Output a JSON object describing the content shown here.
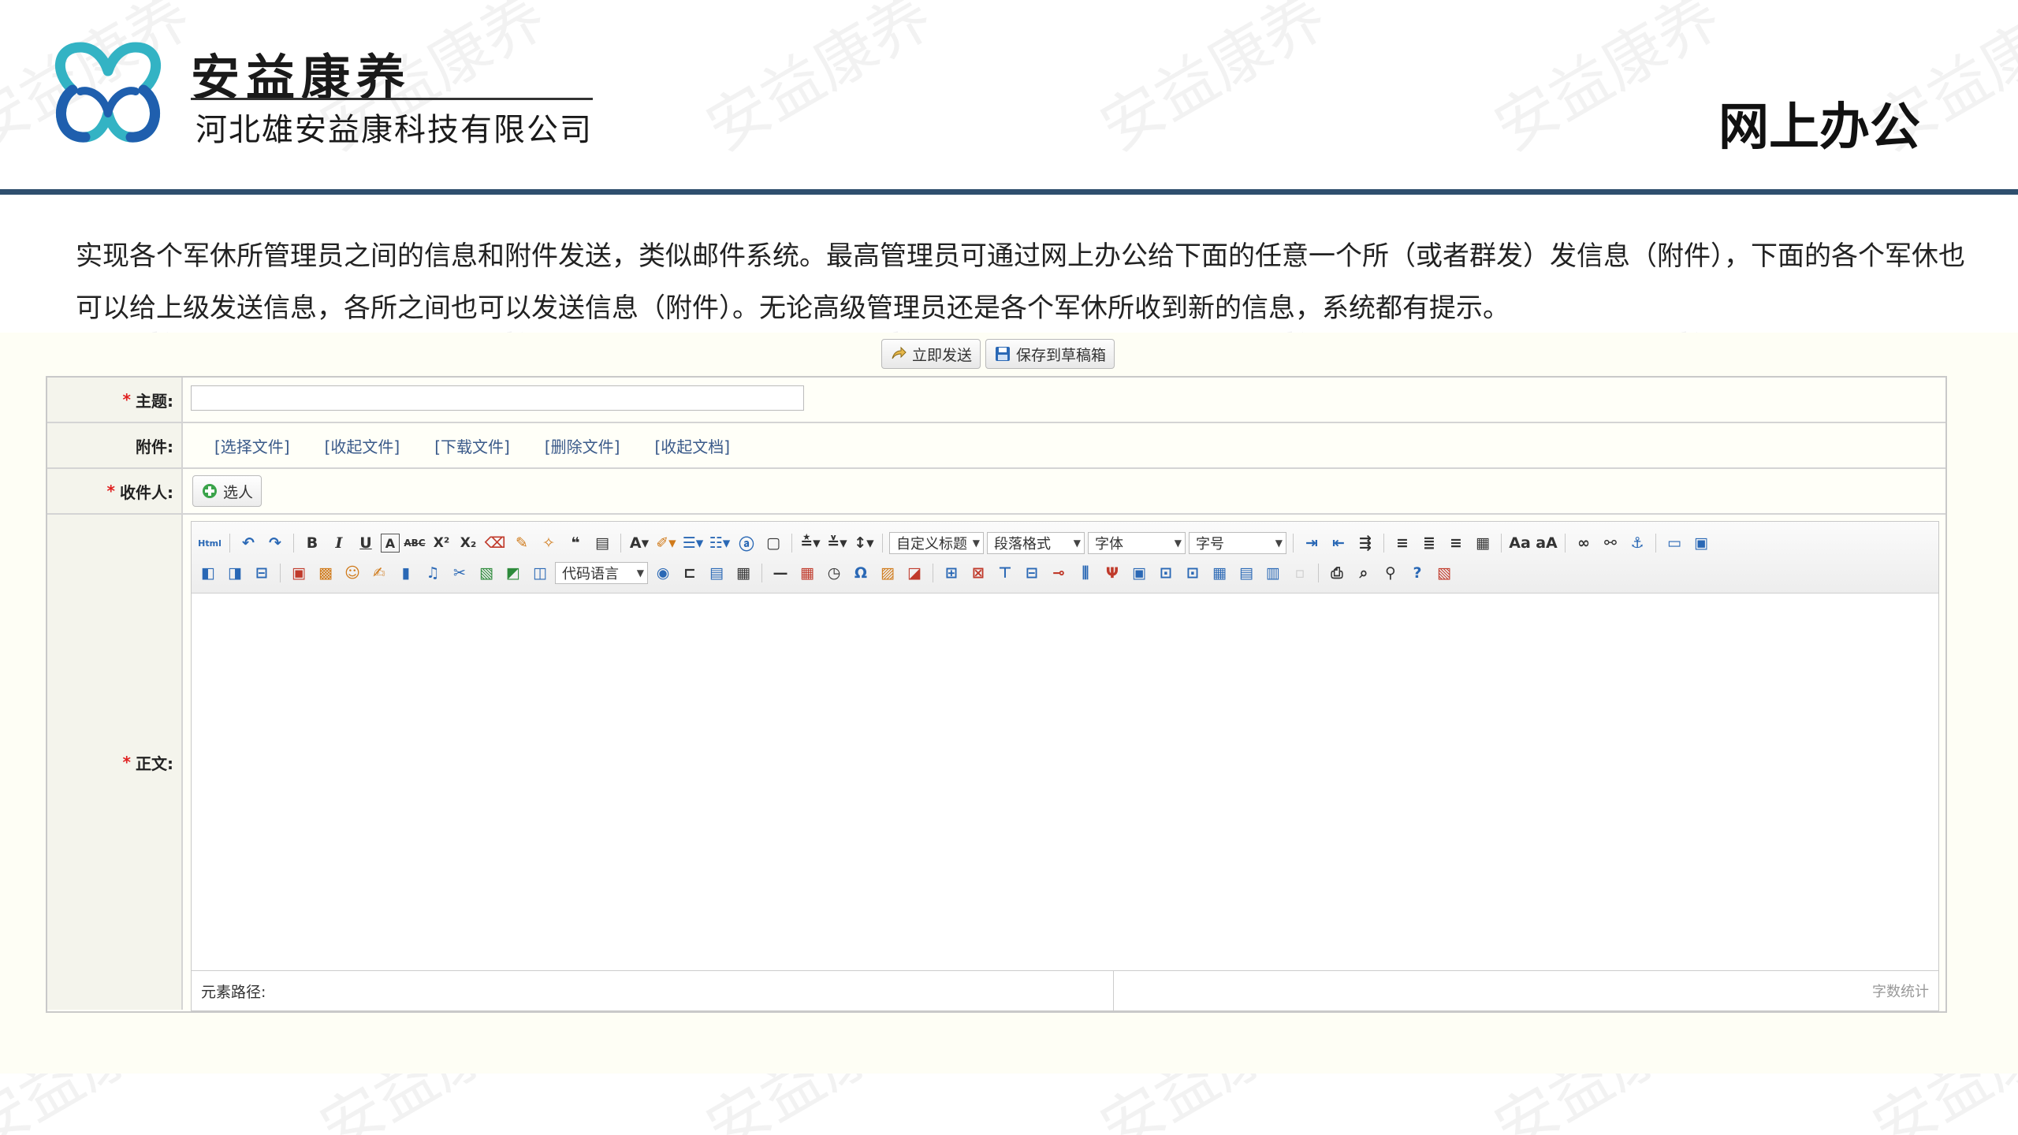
{
  "header": {
    "brand": "安益康养",
    "company": "河北雄安益康科技有限公司",
    "page_title": "网上办公"
  },
  "watermark": "安益康养",
  "description": "实现各个军休所管理员之间的信息和附件发送，类似邮件系统。最高管理员可通过网上办公给下面的任意一个所（或者群发）发信息（附件），下面的各个军休也可以给上级发送信息，各所之间也可以发送信息（附件）。无论高级管理员还是各个军休所收到新的信息，系统都有提示。",
  "actions": {
    "send": "立即发送",
    "save_draft": "保存到草稿箱"
  },
  "form": {
    "subject_label": "主题:",
    "attachment_label": "附件:",
    "attachment_links": [
      "[选择文件]",
      "[收起文件]",
      "[下载文件]",
      "[删除文件]",
      "[收起文档]"
    ],
    "recipient_label": "收件人:",
    "pick_button": "选人",
    "body_label": "正文:",
    "required_mark": "*"
  },
  "editor": {
    "html_label": "Html",
    "custom_heading": "自定义标题",
    "paragraph_format": "段落格式",
    "font_family": "字体",
    "font_size": "字号",
    "code_language": "代码语言",
    "element_path": "元素路径:",
    "word_count": "字数统计"
  },
  "colors": {
    "header_rule": "#2f4f6e",
    "required": "#e02020",
    "link": "#3a5a8a",
    "logo_blue": "#1f5fae",
    "logo_teal": "#33b3c4"
  }
}
